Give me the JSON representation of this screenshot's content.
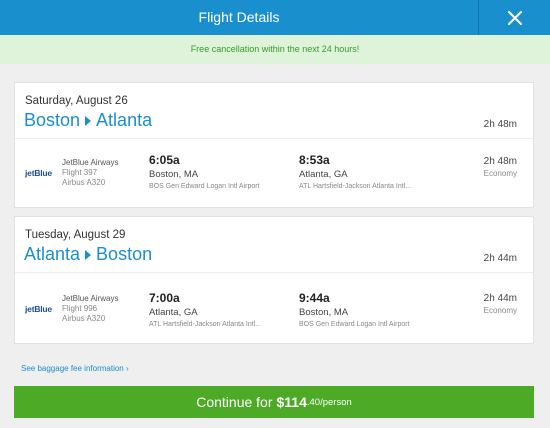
{
  "header": {
    "title": "Flight Details",
    "close_icon": "close-icon"
  },
  "notice": "Free cancellation within the next 24 hours!",
  "flights": [
    {
      "date": "Saturday, August 26",
      "origin": "Boston",
      "destination": "Atlanta",
      "total_duration": "2h 48m",
      "segment": {
        "airline_logo": "jetBlue",
        "airline": "JetBlue Airways",
        "flight": "Flight 397",
        "aircraft": "Airbus A320",
        "dep_time": "6:05a",
        "dep_city": "Boston, MA",
        "dep_airport": "BOS Gen Edward Logan Intl Airport",
        "arr_time": "8:53a",
        "arr_city": "Atlanta, GA",
        "arr_airport": "ATL Hartsfield-Jackson Atlanta Intl...",
        "duration": "2h 48m",
        "cabin": "Economy"
      }
    },
    {
      "date": "Tuesday, August 29",
      "origin": "Atlanta",
      "destination": "Boston",
      "total_duration": "2h 44m",
      "segment": {
        "airline_logo": "jetBlue",
        "airline": "JetBlue Airways",
        "flight": "Flight 996",
        "aircraft": "Airbus A320",
        "dep_time": "7:00a",
        "dep_city": "Atlanta, GA",
        "dep_airport": "ATL Hartsfield-Jackson Atlanta Intl...",
        "arr_time": "9:44a",
        "arr_city": "Boston, MA",
        "arr_airport": "BOS Gen Edward Logan Intl Airport",
        "duration": "2h 44m",
        "cabin": "Economy"
      }
    }
  ],
  "baggage_link": "See baggage fee information ›",
  "continue": {
    "label": "Continue for",
    "price": "$114",
    "suffix": ".40/person"
  },
  "colors": {
    "accent": "#1a8fce",
    "success": "#4caa27",
    "notice_bg": "#dff3da",
    "notice_text": "#3a9a2c"
  }
}
